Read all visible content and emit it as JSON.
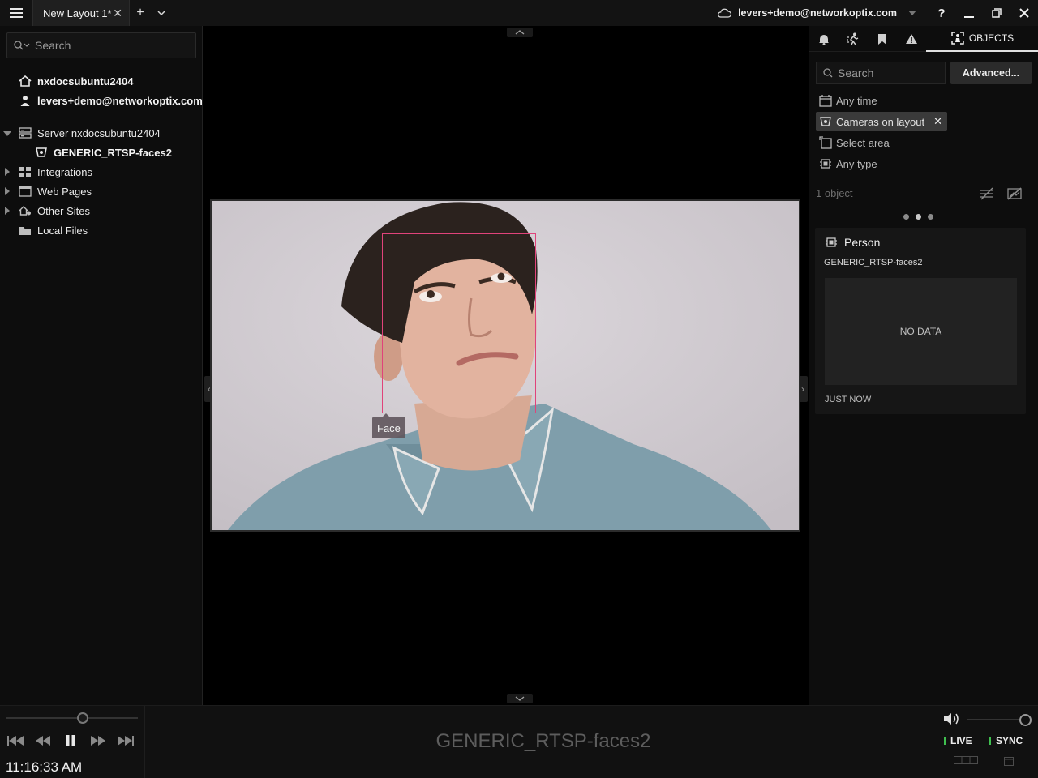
{
  "titlebar": {
    "tab_label": "New Layout 1*",
    "account": "levers+demo@networkoptix.com"
  },
  "left": {
    "search_placeholder": "Search",
    "system_name": "nxdocsubuntu2404",
    "user": "levers+demo@networkoptix.com",
    "server": "Server nxdocsubuntu2404",
    "camera": "GENERIC_RTSP-faces2",
    "integrations": "Integrations",
    "web_pages": "Web Pages",
    "other_sites": "Other Sites",
    "local_files": "Local Files"
  },
  "video": {
    "object_tag": "Face"
  },
  "right": {
    "objects_tab": "OBJECTS",
    "search_placeholder": "Search",
    "advanced_label": "Advanced...",
    "filter_time": "Any time",
    "filter_cameras": "Cameras on layout",
    "filter_area": "Select area",
    "filter_type": "Any type",
    "count": "1 object",
    "card": {
      "title": "Person",
      "camera": "GENERIC_RTSP-faces2",
      "image_placeholder": "NO DATA",
      "time": "JUST NOW"
    }
  },
  "bottom": {
    "time": "11:16:33 AM",
    "camera_name": "GENERIC_RTSP-faces2",
    "live_label": "LIVE",
    "sync_label": "SYNC"
  },
  "colors": {
    "accent_box": "#e0437a",
    "live_led": "#3fbf4f"
  }
}
